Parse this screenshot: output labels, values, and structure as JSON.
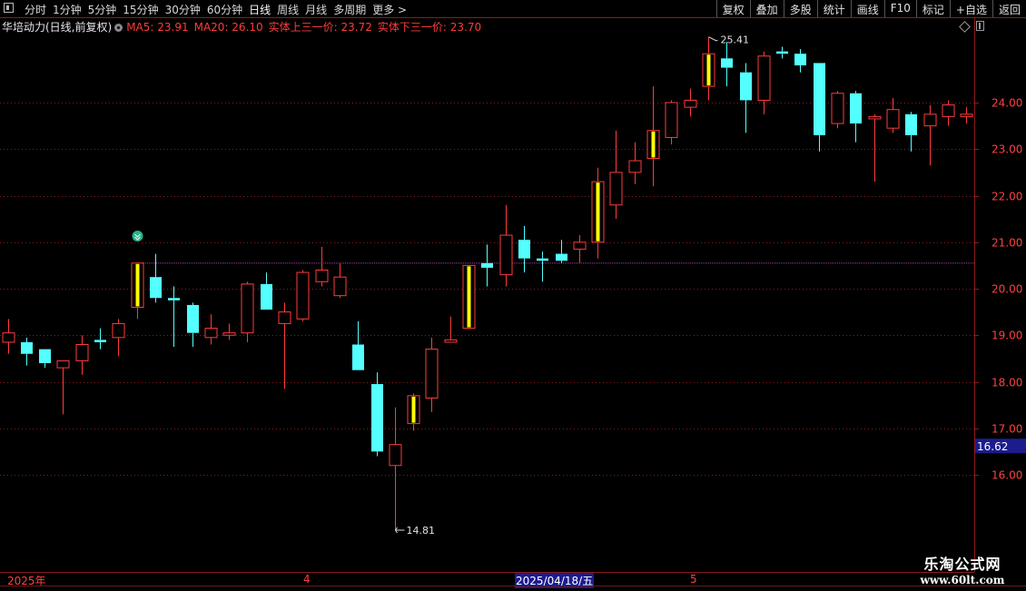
{
  "toolbar": {
    "period_tabs": [
      "分时",
      "1分钟",
      "5分钟",
      "15分钟",
      "30分钟",
      "60分钟",
      "日线",
      "周线",
      "月线",
      "多周期",
      "更多 >"
    ],
    "active_tab": "日线",
    "right_buttons": [
      "复权",
      "叠加",
      "多股",
      "统计",
      "画线",
      "F10",
      "标记",
      "+自选",
      "返回"
    ]
  },
  "info": {
    "stock_title": "华培动力(日线,前复权)",
    "ma5": "MA5: 23.91",
    "ma20": "MA20: 26.10",
    "upper_line": "实体上三一价: 23.72",
    "lower_line": "实体下三一价: 23.70"
  },
  "colors": {
    "up": "#ff3b3b",
    "down": "#54ffff",
    "limit_up_fill": "#ffff00",
    "grid": "#8b1a1a",
    "axis_text": "#ff4040",
    "reference_line": "#b040b0",
    "current_price_bg": "#1c1c8c"
  },
  "chart_data": {
    "type": "candlestick",
    "ylim": [
      14.5,
      26.0
    ],
    "y_ticks": [
      "24.00",
      "23.00",
      "22.00",
      "21.00",
      "20.00",
      "19.00",
      "18.00",
      "17.00",
      "16.00"
    ],
    "current_price": "16.62",
    "reference_price": 20.55,
    "high_label": "25.41",
    "low_label": "14.81",
    "time_labels": [
      "2025年",
      "4",
      "2025/04/18/五",
      "5"
    ],
    "candles": [
      {
        "o": 18.85,
        "h": 19.35,
        "l": 18.6,
        "c": 19.05
      },
      {
        "o": 18.85,
        "h": 18.95,
        "l": 18.35,
        "c": 18.6
      },
      {
        "o": 18.7,
        "h": 18.7,
        "l": 18.3,
        "c": 18.4
      },
      {
        "o": 18.3,
        "h": 18.45,
        "l": 17.3,
        "c": 18.45
      },
      {
        "o": 18.45,
        "h": 19.0,
        "l": 18.15,
        "c": 18.8
      },
      {
        "o": 18.9,
        "h": 19.15,
        "l": 18.7,
        "c": 18.85
      },
      {
        "o": 18.95,
        "h": 19.35,
        "l": 18.55,
        "c": 19.25
      },
      {
        "o": 19.6,
        "h": 20.55,
        "l": 19.35,
        "c": 20.55,
        "limit": true
      },
      {
        "o": 20.25,
        "h": 20.75,
        "l": 19.7,
        "c": 19.8
      },
      {
        "o": 19.8,
        "h": 20.05,
        "l": 18.75,
        "c": 19.75
      },
      {
        "o": 19.65,
        "h": 19.7,
        "l": 18.75,
        "c": 19.05
      },
      {
        "o": 18.95,
        "h": 19.45,
        "l": 18.8,
        "c": 19.15
      },
      {
        "o": 19.0,
        "h": 19.25,
        "l": 18.9,
        "c": 19.05
      },
      {
        "o": 19.05,
        "h": 20.15,
        "l": 18.85,
        "c": 20.1
      },
      {
        "o": 20.1,
        "h": 20.35,
        "l": 19.55,
        "c": 19.55
      },
      {
        "o": 19.25,
        "h": 19.7,
        "l": 17.85,
        "c": 19.5
      },
      {
        "o": 19.35,
        "h": 20.4,
        "l": 19.3,
        "c": 20.35
      },
      {
        "o": 20.15,
        "h": 20.9,
        "l": 20.05,
        "c": 20.4
      },
      {
        "o": 19.85,
        "h": 20.55,
        "l": 19.8,
        "c": 20.25
      },
      {
        "o": 18.8,
        "h": 19.3,
        "l": 18.25,
        "c": 18.25
      },
      {
        "o": 17.95,
        "h": 18.2,
        "l": 16.4,
        "c": 16.5
      },
      {
        "o": 16.2,
        "h": 17.45,
        "l": 14.81,
        "c": 16.65
      },
      {
        "o": 17.1,
        "h": 17.75,
        "l": 16.95,
        "c": 17.7,
        "limit": true
      },
      {
        "o": 17.65,
        "h": 18.95,
        "l": 17.35,
        "c": 18.7
      },
      {
        "o": 18.85,
        "h": 19.4,
        "l": 18.85,
        "c": 18.9
      },
      {
        "o": 19.15,
        "h": 20.5,
        "l": 19.15,
        "c": 20.5,
        "limit": true
      },
      {
        "o": 20.55,
        "h": 20.95,
        "l": 20.05,
        "c": 20.45
      },
      {
        "o": 20.3,
        "h": 21.8,
        "l": 20.05,
        "c": 21.15
      },
      {
        "o": 21.05,
        "h": 21.35,
        "l": 20.35,
        "c": 20.65
      },
      {
        "o": 20.65,
        "h": 20.8,
        "l": 20.15,
        "c": 20.6
      },
      {
        "o": 20.75,
        "h": 21.05,
        "l": 20.55,
        "c": 20.6
      },
      {
        "o": 20.85,
        "h": 21.15,
        "l": 20.55,
        "c": 21.0
      },
      {
        "o": 21.0,
        "h": 22.6,
        "l": 20.65,
        "c": 22.3,
        "limit": true
      },
      {
        "o": 21.8,
        "h": 23.4,
        "l": 21.5,
        "c": 22.5
      },
      {
        "o": 22.5,
        "h": 23.15,
        "l": 22.25,
        "c": 22.75
      },
      {
        "o": 22.8,
        "h": 24.35,
        "l": 22.2,
        "c": 23.4,
        "limit": true
      },
      {
        "o": 23.25,
        "h": 24.05,
        "l": 23.1,
        "c": 24.0
      },
      {
        "o": 23.9,
        "h": 24.3,
        "l": 23.7,
        "c": 24.05
      },
      {
        "o": 24.35,
        "h": 25.41,
        "l": 24.05,
        "c": 25.05,
        "limit": true
      },
      {
        "o": 24.95,
        "h": 25.3,
        "l": 24.35,
        "c": 24.75
      },
      {
        "o": 24.65,
        "h": 24.85,
        "l": 23.35,
        "c": 24.05
      },
      {
        "o": 24.05,
        "h": 25.1,
        "l": 23.75,
        "c": 25.0
      },
      {
        "o": 25.1,
        "h": 25.2,
        "l": 24.95,
        "c": 25.05
      },
      {
        "o": 25.05,
        "h": 25.15,
        "l": 24.65,
        "c": 24.8
      },
      {
        "o": 24.85,
        "h": 24.85,
        "l": 22.95,
        "c": 23.3
      },
      {
        "o": 23.55,
        "h": 24.25,
        "l": 23.45,
        "c": 24.2
      },
      {
        "o": 24.2,
        "h": 24.25,
        "l": 23.15,
        "c": 23.55
      },
      {
        "o": 23.65,
        "h": 23.75,
        "l": 22.3,
        "c": 23.7
      },
      {
        "o": 23.45,
        "h": 24.1,
        "l": 23.35,
        "c": 23.85
      },
      {
        "o": 23.75,
        "h": 23.8,
        "l": 22.95,
        "c": 23.3
      },
      {
        "o": 23.5,
        "h": 23.95,
        "l": 22.65,
        "c": 23.75
      },
      {
        "o": 23.7,
        "h": 24.05,
        "l": 23.5,
        "c": 23.95
      },
      {
        "o": 23.7,
        "h": 23.9,
        "l": 23.55,
        "c": 23.75
      }
    ]
  },
  "watermark": {
    "title": "乐淘公式网",
    "url": "www.60lt.com"
  }
}
